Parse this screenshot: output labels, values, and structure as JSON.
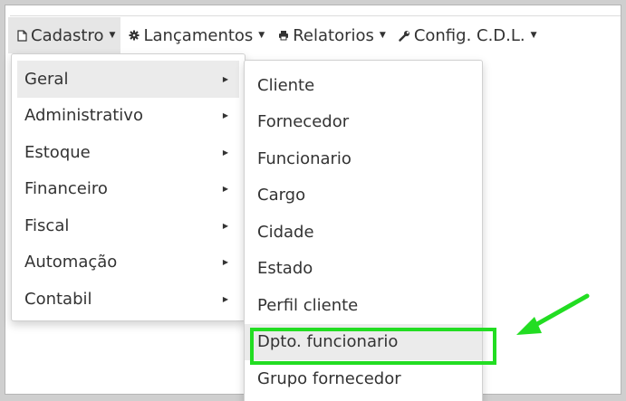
{
  "navbar": {
    "items": [
      {
        "label": "Cadastro",
        "icon": "document-icon"
      },
      {
        "label": "Lançamentos",
        "icon": "gear-icon"
      },
      {
        "label": "Relatorios",
        "icon": "printer-icon"
      },
      {
        "label": "Config. C.D.L.",
        "icon": "wrench-icon"
      }
    ]
  },
  "menu_main": {
    "items": [
      {
        "label": "Geral"
      },
      {
        "label": "Administrativo"
      },
      {
        "label": "Estoque"
      },
      {
        "label": "Financeiro"
      },
      {
        "label": "Fiscal"
      },
      {
        "label": "Automação"
      },
      {
        "label": "Contabil"
      }
    ]
  },
  "menu_geral": {
    "items": [
      {
        "label": "Cliente"
      },
      {
        "label": "Fornecedor"
      },
      {
        "label": "Funcionario"
      },
      {
        "label": "Cargo"
      },
      {
        "label": "Cidade"
      },
      {
        "label": "Estado"
      },
      {
        "label": "Perfil cliente"
      },
      {
        "label": "Dpto. funcionario"
      },
      {
        "label": "Grupo fornecedor"
      }
    ]
  },
  "colors": {
    "highlight_box": "#22dd22",
    "active_bg": "#e6e6e6"
  }
}
